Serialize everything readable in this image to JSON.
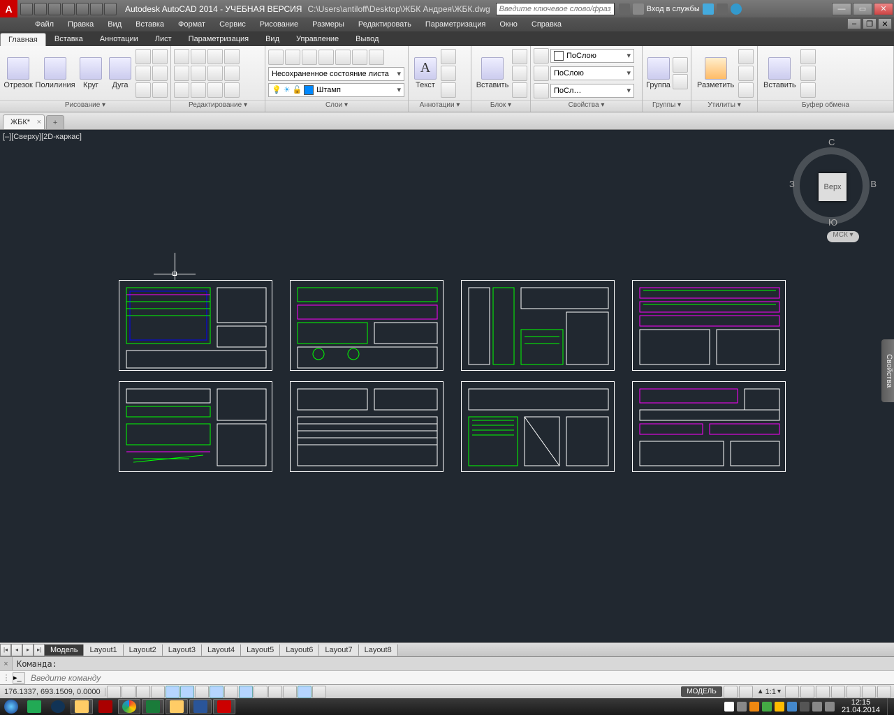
{
  "title": {
    "app": "Autodesk AutoCAD 2014 - УЧЕБНАЯ ВЕРСИЯ",
    "path": "C:\\Users\\antiloff\\Desktop\\ЖБК Андрея\\ЖБК.dwg",
    "search_placeholder": "Введите ключевое слово/фразу",
    "signin": "Вход в службы"
  },
  "menus": [
    "Файл",
    "Правка",
    "Вид",
    "Вставка",
    "Формат",
    "Сервис",
    "Рисование",
    "Размеры",
    "Редактировать",
    "Параметризация",
    "Окно",
    "Справка"
  ],
  "ribbon_tabs": [
    "Главная",
    "Вставка",
    "Аннотации",
    "Лист",
    "Параметризация",
    "Вид",
    "Управление",
    "Вывод"
  ],
  "panels": {
    "draw": {
      "title": "Рисование ▾",
      "line": "Отрезок",
      "polyline": "Полилиния",
      "circle": "Круг",
      "arc": "Дуга"
    },
    "modify": {
      "title": "Редактирование ▾"
    },
    "layers": {
      "title": "Слои ▾",
      "state": "Несохраненное состояние листа",
      "current": "Штамп"
    },
    "annot": {
      "title": "Аннотации ▾",
      "text": "Текст"
    },
    "block": {
      "title": "Блок ▾",
      "insert": "Вставить"
    },
    "props": {
      "title": "Свойства ▾",
      "color": "ПоСлою",
      "ltype": "ПоСлою",
      "lweight": "ПоСл…"
    },
    "groups": {
      "title": "Группы ▾",
      "group": "Группа"
    },
    "utils": {
      "title": "Утилиты ▾",
      "measure": "Разметить"
    },
    "clip": {
      "title": "Буфер обмена",
      "paste": "Вставить"
    }
  },
  "filetab": "ЖБК*",
  "viewlabel": "[–][Сверху][2D-каркас]",
  "viewcube": {
    "top": "Верх",
    "n": "С",
    "s": "Ю",
    "e": "В",
    "w": "З",
    "wcs": "МСК ▾"
  },
  "side_panel": "Свойства",
  "layout_tabs": {
    "model": "Модель",
    "layouts": [
      "Layout1",
      "Layout2",
      "Layout3",
      "Layout4",
      "Layout5",
      "Layout6",
      "Layout7",
      "Layout8"
    ]
  },
  "command": {
    "prompt": "Команда:",
    "placeholder": "Введите команду"
  },
  "status": {
    "coords": "176.1337, 693.1509, 0.0000",
    "model": "МОДЕЛЬ",
    "scale": "1:1"
  },
  "clock": {
    "time": "12:15",
    "date": "21.04.2014"
  }
}
